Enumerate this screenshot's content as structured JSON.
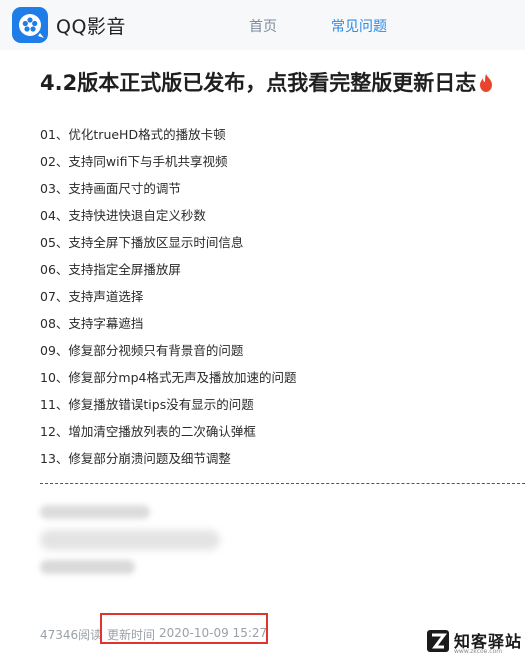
{
  "header": {
    "app_name": "QQ影音",
    "nav": {
      "home": "首页",
      "faq": "常见问题"
    }
  },
  "article": {
    "title": "4.2版本正式版已发布，点我看完整版更新日志",
    "items": [
      "01、优化trueHD格式的播放卡顿",
      "02、支持同wifi下与手机共享视频",
      "03、支持画面尺寸的调节",
      "04、支持快进快退自定义秒数",
      "05、支持全屏下播放区显示时间信息",
      "06、支持指定全屏播放屏",
      "07、支持声道选择",
      "08、支持字幕遮挡",
      "09、修复部分视频只有背景音的问题",
      "10、修复部分mp4格式无声及播放加速的问题",
      "11、修复播放错误tips没有显示的问题",
      "12、增加清空播放列表的二次确认弹框",
      "13、修复部分崩溃问题及细节调整"
    ],
    "divider": "------------------------------------------------------------------------------------------------"
  },
  "footer": {
    "reads": "47346阅读",
    "update_label": "更新时间",
    "update_time": "2020-10-09 15:27"
  },
  "watermark": {
    "text": "知客驿站",
    "url": "www.zkcoe.com"
  },
  "colors": {
    "accent": "#2b8be6",
    "highlight": "#e0352b",
    "muted": "#9aa1a8"
  },
  "icons": {
    "logo": "qq-player-logo-icon",
    "fire": "fire-icon"
  }
}
